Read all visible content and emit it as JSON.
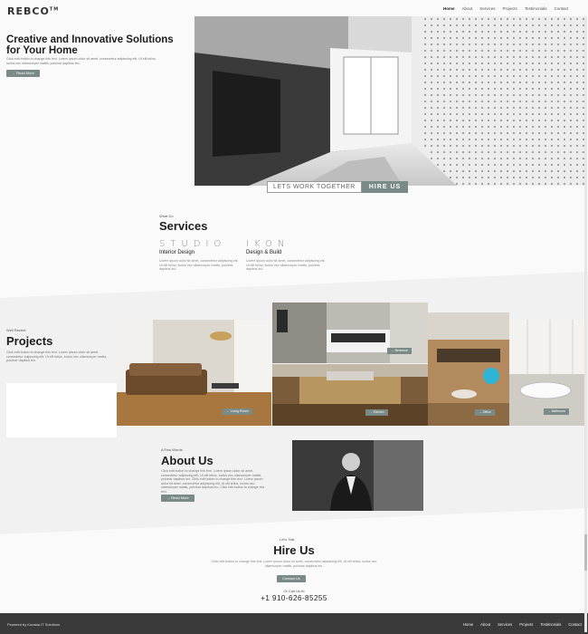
{
  "header": {
    "logo": "REBCO",
    "logo_mark": "TM",
    "nav": [
      "Home",
      "About",
      "Services",
      "Projects",
      "Testimonials",
      "Contact"
    ]
  },
  "hero": {
    "title": "Creative and Innovative Solutions for Your Home",
    "text": "Click edit button to change this text. Lorem ipsum dolor sit amet, consectetur adipiscing elit. Ut elit tellus, luctus nec ullamcorper mattis, pulvinar dapibus leo.",
    "button": "→ Read More",
    "banner_left": "LETS WORK TOGETHER",
    "banner_right": "HIRE US"
  },
  "services": {
    "kicker": "What Do",
    "title": "Services",
    "items": [
      {
        "big": "STUDIO",
        "name": "Interior Design",
        "text": "Lorem ipsum dolor sit amet, consectetur adipiscing elit. Ut elit tellus, luctus nec ullamcorper mattis, pulvinar dapibus leo."
      },
      {
        "big": "IKON",
        "name": "Design & Build",
        "text": "Lorem ipsum dolor sit amet, consectetur adipiscing elit. Ut elit tellus, luctus nec ullamcorper mattis, pulvinar dapibus leo."
      }
    ]
  },
  "projects": {
    "kicker": "Well Recent",
    "title": "Projects",
    "text": "Click edit button to change this text. Lorem ipsum dolor sit amet, consectetur adipiscing elit. Ut elit tellus, luctus nec ullamcorper mattis, pulvinar dapibus leo.",
    "tiles": [
      "→ Living Room",
      "→ Bedroom",
      "→ Kitchen",
      "→ Office",
      "→ Bathroom"
    ]
  },
  "about": {
    "kicker": "A Few Words",
    "title": "About Us",
    "text": "Click edit button to change this text. Lorem ipsum dolor sit amet, consectetur adipiscing elit. Ut elit tellus, luctus nec ullamcorper mattis, pulvinar dapibus leo. Click edit button to change this text. Lorem ipsum dolor sit amet, consectetur adipiscing elit. Ut elit tellus, luctus nec ullamcorper mattis, pulvinar dapibus leo. Click edit button to change this text.",
    "button": "→ Read More"
  },
  "hire": {
    "kicker": "Let's Talk",
    "title": "Hire Us",
    "text": "Click edit button to change this text. Lorem ipsum dolor sit amet, consectetur adipiscing elit. Ut elit tellus, luctus nec ullamcorper mattis, pulvinar dapibus leo.",
    "button": "Contact Us",
    "call_label": "Or Call Us At",
    "phone": "+1 910-626-85255"
  },
  "footer": {
    "credit": "Powered by Kurasta IT Solutions",
    "nav": [
      "Home",
      "About",
      "Services",
      "Projects",
      "Testimonials",
      "Contact"
    ]
  }
}
